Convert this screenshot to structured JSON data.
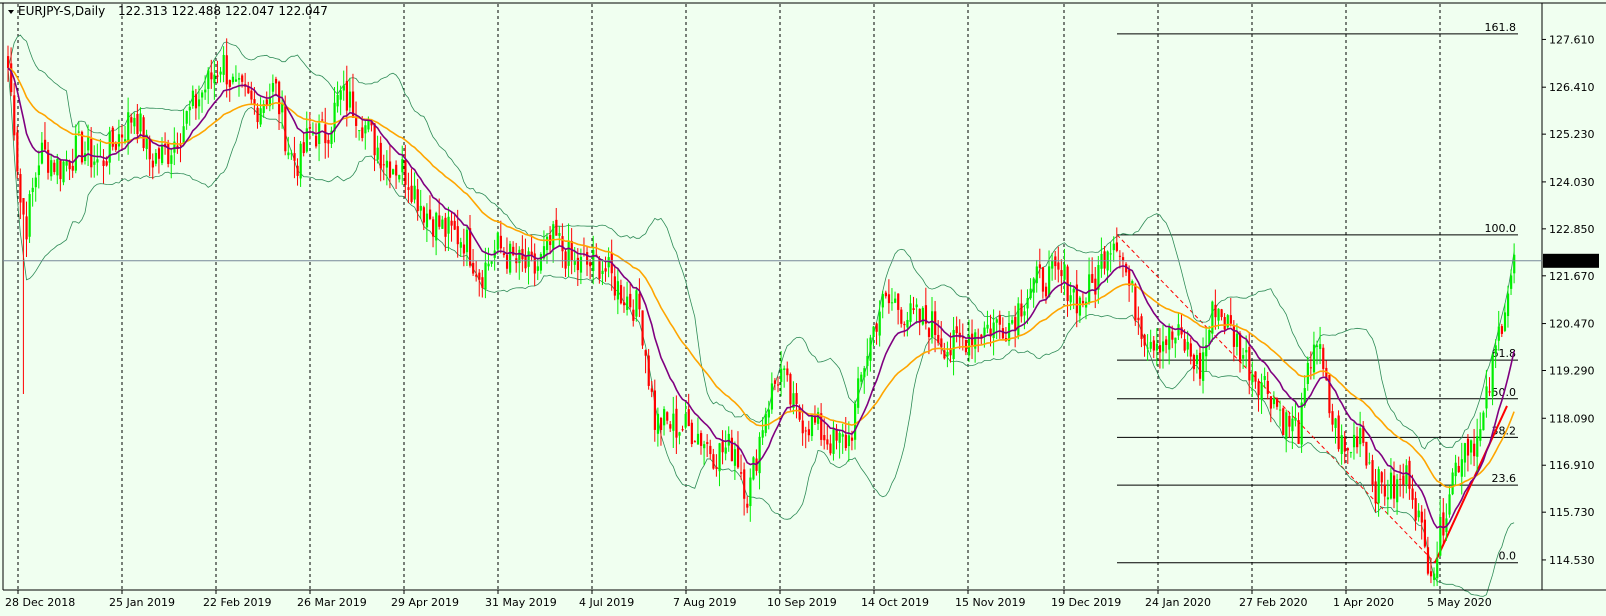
{
  "window": {
    "symbol_label": "EURJPY-S,Daily",
    "ohlc_label": "122.313 122.488 122.047 122.047",
    "current_price": "122.047"
  },
  "chart_data": {
    "type": "candlestick",
    "symbol": "EURJPY-S",
    "timeframe": "Daily",
    "ylim": [
      113.9,
      128.4
    ],
    "y_ticks": [
      "127.610",
      "126.410",
      "125.230",
      "124.030",
      "122.850",
      "121.670",
      "120.470",
      "119.290",
      "118.090",
      "116.910",
      "115.730",
      "114.530"
    ],
    "x_ticks": [
      "28 Dec 2018",
      "25 Jan 2019",
      "22 Feb 2019",
      "26 Mar 2019",
      "29 Apr 2019",
      "31 May 2019",
      "4 Jul 2019",
      "7 Aug 2019",
      "10 Sep 2019",
      "14 Oct 2019",
      "15 Nov 2019",
      "19 Dec 2019",
      "24 Jan 2020",
      "27 Feb 2020",
      "1 Apr 2020",
      "5 May 2020"
    ],
    "vertical_grid": "dashed, one per x tick",
    "horizontal_grid": false,
    "fibonacci": {
      "levels": [
        {
          "label": "161.8",
          "price": 127.75
        },
        {
          "label": "100.0",
          "price": 122.7
        },
        {
          "label": "61.8",
          "price": 119.55
        },
        {
          "label": "50.0",
          "price": 118.58
        },
        {
          "label": "38.2",
          "price": 117.61
        },
        {
          "label": "23.6",
          "price": 116.41
        },
        {
          "label": "0.0",
          "price": 114.46
        }
      ]
    },
    "key_points": [
      {
        "date": "28 Dec 2018",
        "close": 126.9
      },
      {
        "date": "3 Jan 2019",
        "low": 118.7
      },
      {
        "date": "22 Feb 2019",
        "high": 127.3
      },
      {
        "date": "29 Apr 2019",
        "close": 124.5
      },
      {
        "date": "31 May 2019",
        "close": 121.8
      },
      {
        "date": "26 Aug 2019",
        "low": 116.0
      },
      {
        "date": "10 Sep 2019",
        "close": 119.5
      },
      {
        "date": "15 Nov 2019",
        "close": 120.5
      },
      {
        "date": "26 Dec 2019",
        "high": 122.75
      },
      {
        "date": "6 May 2020",
        "low": 114.45
      },
      {
        "date": "5 Jun 2020",
        "close": 122.05
      }
    ],
    "series": [
      {
        "name": "Bollinger upper",
        "color": "#2e8b57"
      },
      {
        "name": "Bollinger lower",
        "color": "#2e8b57"
      },
      {
        "name": "EMA fast",
        "color": "#800080"
      },
      {
        "name": "EMA slow",
        "color": "#ffa500"
      }
    ],
    "colors": {
      "background": "#f0fff0",
      "bull": "#00ee00",
      "bear": "#ff0000",
      "grid": "#000000"
    }
  }
}
